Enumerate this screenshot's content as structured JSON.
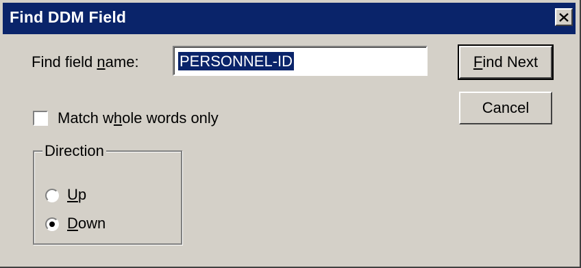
{
  "window": {
    "title": "Find DDM Field",
    "close_glyph": "✕"
  },
  "find_field": {
    "label_prefix": "Find field ",
    "label_accel": "n",
    "label_suffix": "ame:",
    "value": "PERSONNEL-ID"
  },
  "buttons": {
    "find_next_accel": "F",
    "find_next_rest": "ind Next",
    "cancel": "Cancel"
  },
  "options": {
    "match_whole_prefix": "Match w",
    "match_whole_accel": "h",
    "match_whole_suffix": "ole words only",
    "match_whole_checked": false
  },
  "direction": {
    "legend": "Direction",
    "up_accel": "U",
    "up_rest": "p",
    "down_accel": "D",
    "down_rest": "own",
    "selected": "Down"
  }
}
